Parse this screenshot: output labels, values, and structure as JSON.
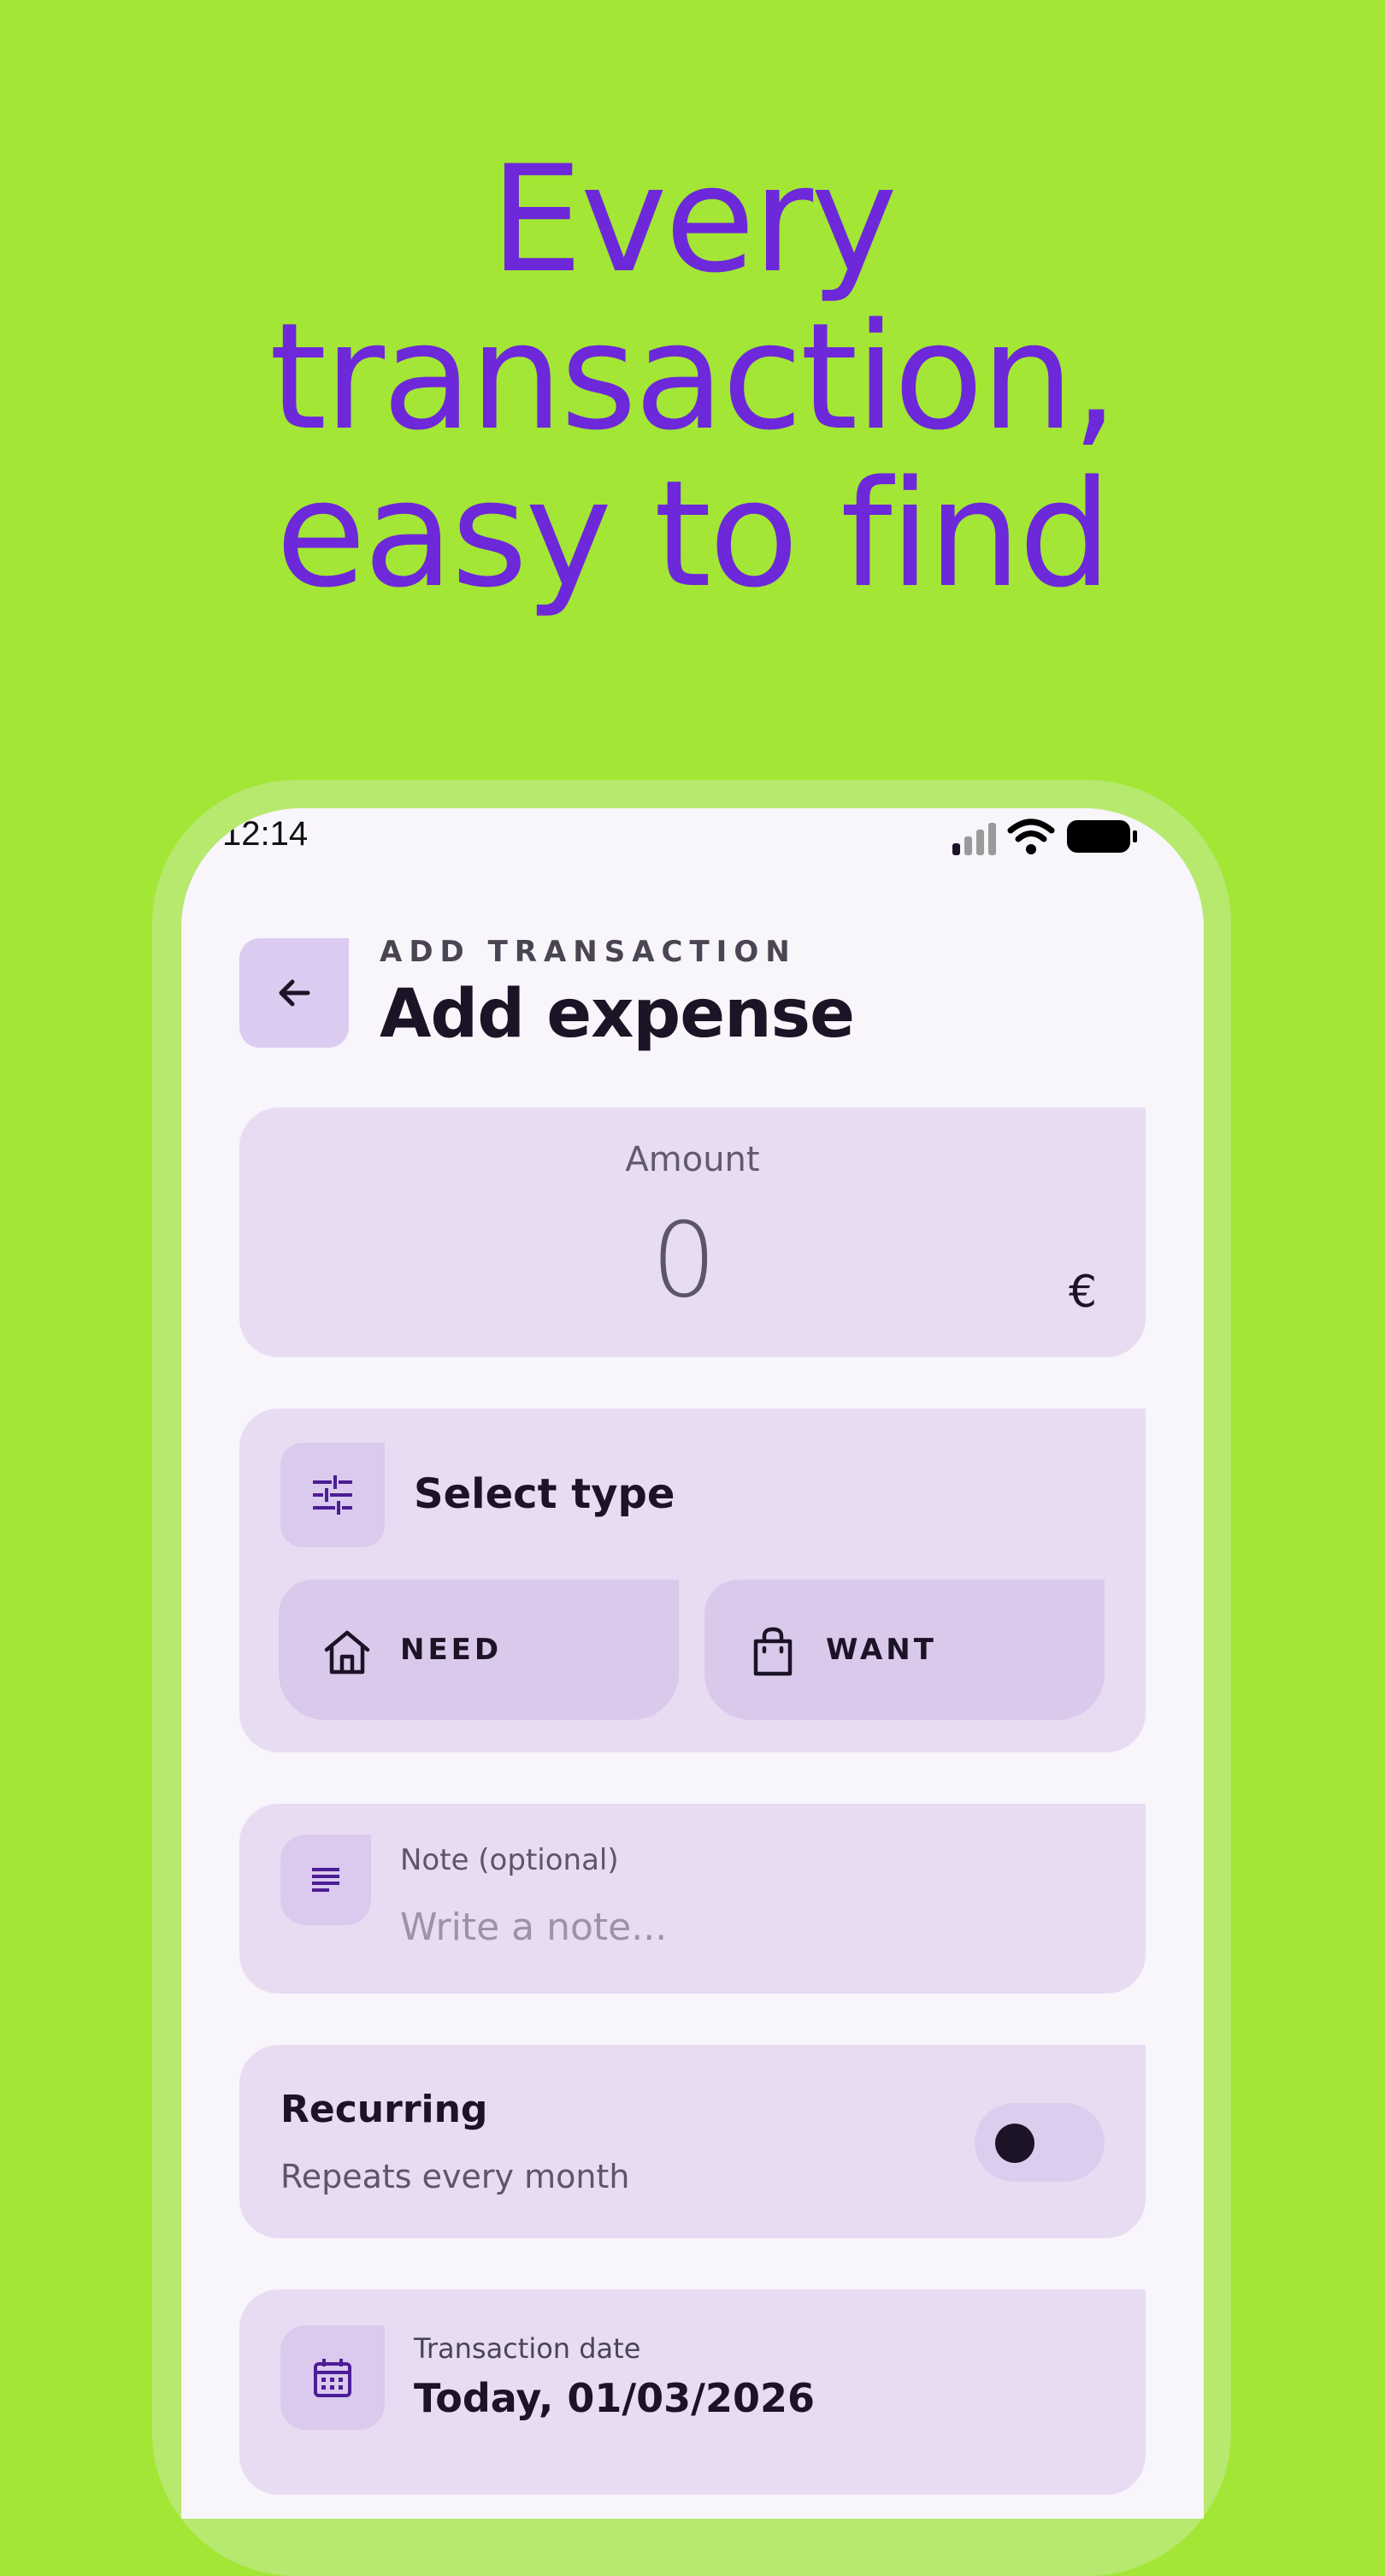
{
  "hero": {
    "lines": [
      "Every",
      "transaction,",
      "easy to find"
    ]
  },
  "status_bar": {
    "time": "12:14"
  },
  "header": {
    "eyebrow": "ADD TRANSACTION",
    "title": "Add expense"
  },
  "amount": {
    "label": "Amount",
    "value": "0",
    "currency": "€"
  },
  "type": {
    "title": "Select type",
    "options": [
      {
        "label": "NEED",
        "icon": "home-icon"
      },
      {
        "label": "WANT",
        "icon": "shopping-bag-icon"
      }
    ]
  },
  "note": {
    "label": "Note (optional)",
    "placeholder": "Write a note...",
    "value": ""
  },
  "recurring": {
    "title": "Recurring",
    "subtitle": "Repeats every month",
    "enabled": false
  },
  "date": {
    "label": "Transaction date",
    "value": "Today, 01/03/2026"
  },
  "colors": {
    "background": "#a3e635",
    "hero_text": "#6d28d9",
    "card": "#e8dcf3",
    "accent": "#4c1d95"
  }
}
